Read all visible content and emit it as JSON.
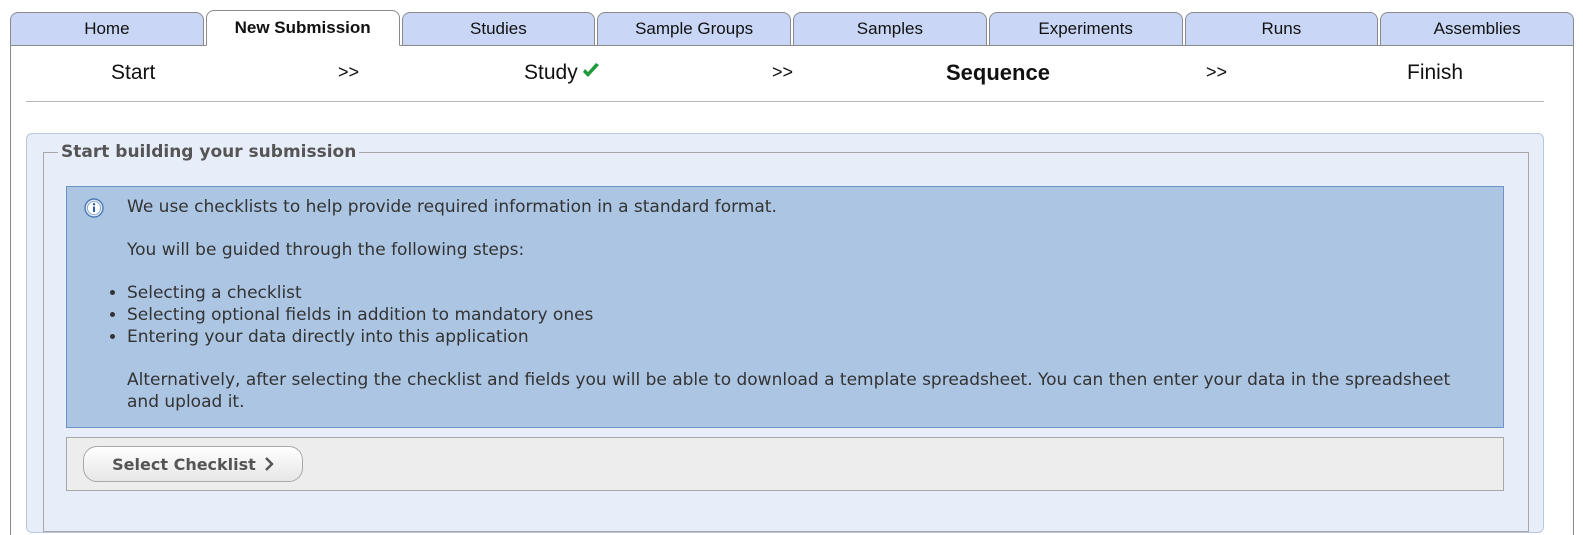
{
  "tabs": [
    {
      "label": "Home",
      "active": false
    },
    {
      "label": "New Submission",
      "active": true
    },
    {
      "label": "Studies",
      "active": false
    },
    {
      "label": "Sample Groups",
      "active": false
    },
    {
      "label": "Samples",
      "active": false
    },
    {
      "label": "Experiments",
      "active": false
    },
    {
      "label": "Runs",
      "active": false
    },
    {
      "label": "Assemblies",
      "active": false
    }
  ],
  "steps": {
    "start": "Start",
    "sep1": ">>",
    "study": "Study",
    "sep2": ">>",
    "sequence": "Sequence",
    "sep3": ">>",
    "finish": "Finish",
    "study_status_icon": "checkmark-icon",
    "check_color": "#1f9a3a"
  },
  "panel": {
    "legend": "Start building your submission",
    "info": {
      "icon": "info-icon",
      "p1": "We use checklists to help provide required information in a standard format.",
      "p2": "You will be guided through the following steps:",
      "items": [
        "Selecting a checklist",
        "Selecting optional fields in addition to mandatory ones",
        "Entering your data directly into this application"
      ],
      "p3": "Alternatively, after selecting the checklist and fields you will be able to download a template spreadsheet. You can then enter your data in the spreadsheet and upload it."
    },
    "button": {
      "label": "Select Checklist",
      "icon": "chevron-right-icon"
    }
  },
  "colors": {
    "tab_bg": "#c9d6f5",
    "info_bg": "#abc5e3",
    "panel_bg": "#e8eef9"
  }
}
